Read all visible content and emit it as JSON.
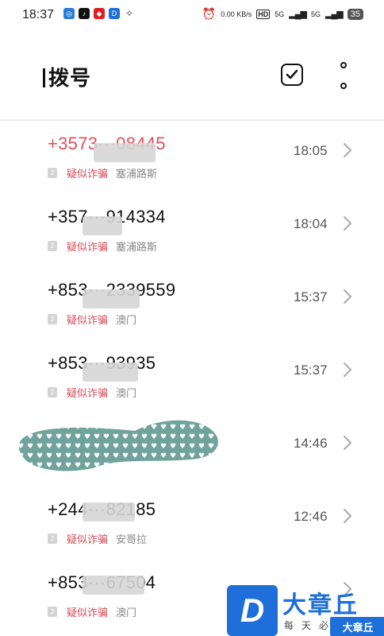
{
  "status": {
    "time": "18:37",
    "net_speed": "0.00 KB/s",
    "hd": "HD",
    "sig1": "5G",
    "sig2": "5G",
    "battery": "35"
  },
  "header": {
    "title": "拨号"
  },
  "calls": [
    {
      "number": "+3573···08445",
      "tag": "疑似诈骗",
      "location": "塞浦路斯",
      "time": "18:05",
      "red": true
    },
    {
      "number": "+357···914334",
      "tag": "疑似诈骗",
      "location": "塞浦路斯",
      "time": "18:04",
      "red": false
    },
    {
      "number": "+853···2339559",
      "tag": "疑似诈骗",
      "location": "澳门",
      "time": "15:37",
      "red": false
    },
    {
      "number": "+853···93935",
      "tag": "疑似诈骗",
      "location": "澳门",
      "time": "15:37",
      "red": false
    },
    {
      "number": "",
      "tag": "",
      "location": "",
      "time": "14:46",
      "red": false
    },
    {
      "number": "+244···82185",
      "tag": "疑似诈骗",
      "location": "安哥拉",
      "time": "12:46",
      "red": false
    },
    {
      "number": "+853···67504",
      "tag": "疑似诈骗",
      "location": "澳门",
      "time": "",
      "red": false
    }
  ],
  "sim_label": "2",
  "watermark": {
    "logo": "D",
    "brand": "大章丘",
    "sub": "每天必看",
    "small": "大章丘"
  },
  "colors": {
    "suspect_red": "#e0505a",
    "tag_red": "#d24b55",
    "brand_blue": "#1e6fd9"
  }
}
